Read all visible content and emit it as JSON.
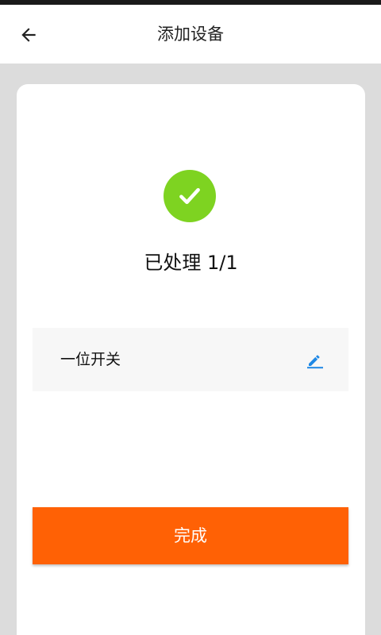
{
  "header": {
    "title": "添加设备",
    "back_icon": "arrow-left-icon"
  },
  "result": {
    "status_icon": "check-circle-icon",
    "status_color": "#7ed321",
    "processed_text": "已处理 1/1"
  },
  "device": {
    "name": "一位开关",
    "edit_icon": "pencil-icon",
    "edit_color": "#1e88e5"
  },
  "actions": {
    "done_label": "完成",
    "done_color": "#ff6105"
  }
}
